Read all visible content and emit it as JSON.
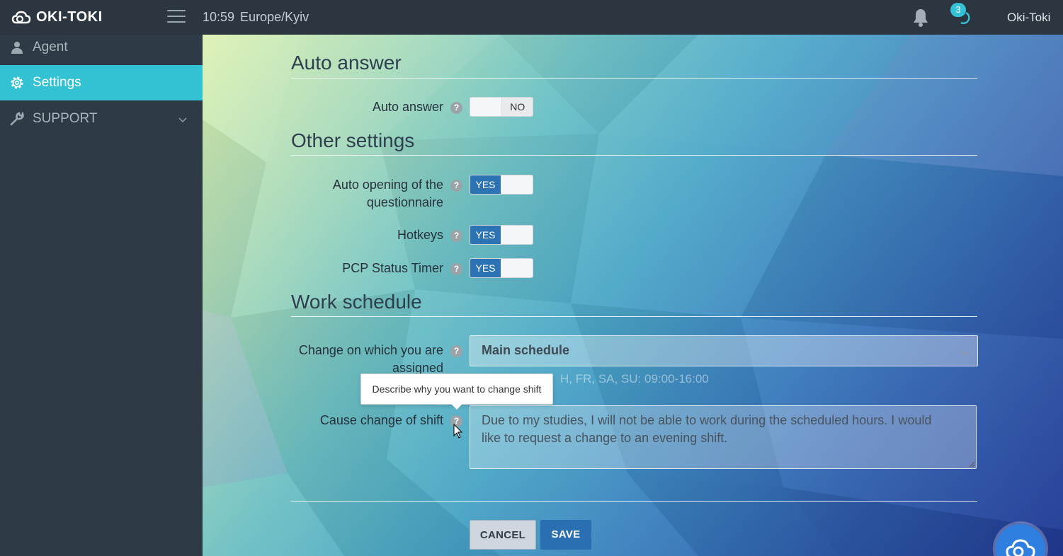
{
  "header": {
    "logo_text": "OKI-TOKI",
    "time": "10:59",
    "timezone": "Europe/Kyiv",
    "notification_count": "3",
    "username": "Oki-Toki"
  },
  "sidebar": {
    "items": [
      {
        "label": "Agent",
        "icon": "user-icon"
      },
      {
        "label": "Settings",
        "icon": "gear-icon",
        "active": true
      },
      {
        "label": "SUPPORT",
        "icon": "wrench-icon"
      }
    ]
  },
  "sections": {
    "auto_answer": {
      "title": "Auto answer",
      "fields": {
        "auto_answer": {
          "label": "Auto answer",
          "value": "NO"
        }
      }
    },
    "other": {
      "title": "Other settings",
      "fields": {
        "auto_open_line1": "Auto opening of the",
        "auto_open_line2": "questionnaire",
        "auto_open_value": "YES",
        "hotkeys_label": "Hotkeys",
        "hotkeys_value": "YES",
        "pcp_label": "PCP Status Timer",
        "pcp_value": "YES"
      }
    },
    "work_schedule": {
      "title": "Work schedule",
      "shift_label_line1": "Change on which you are",
      "shift_label_line2": "assigned",
      "shift_value": "Main schedule",
      "shift_hint": "H, FR, SA, SU: 09:00-16:00",
      "cause_label": "Cause change of shift",
      "cause_value": "Due to my studies, I will not be able to work during the scheduled hours. I would like to request a change to an evening shift.",
      "tooltip": "Describe why you want to change shift"
    }
  },
  "buttons": {
    "cancel": "CANCEL",
    "save": "SAVE"
  },
  "help_glyph": "?",
  "colors": {
    "accent": "#33c1d4",
    "primary": "#2b6fb3",
    "sidebar_bg": "#2e3a46",
    "topbar_bg": "#2b3641"
  }
}
